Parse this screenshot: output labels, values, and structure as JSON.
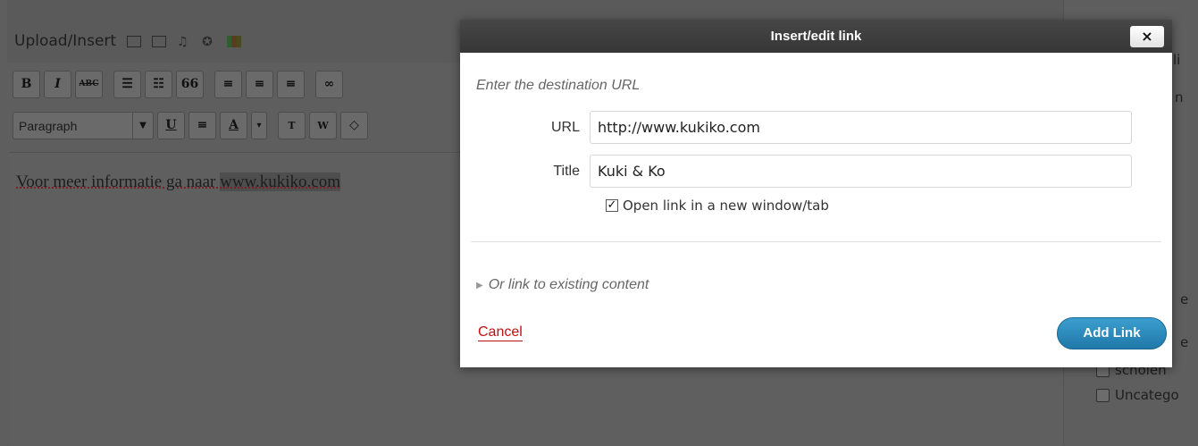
{
  "editor": {
    "upload_label": "Upload/Insert",
    "upload_icons": [
      "image-icon",
      "gallery-icon",
      "audio-icon",
      "media-icon",
      "color-icon"
    ],
    "toolbar1": [
      {
        "name": "bold-button",
        "label": "B"
      },
      {
        "name": "italic-button",
        "label": "I"
      },
      {
        "name": "strikethrough-button",
        "label": "ABC"
      },
      {
        "name": "bullet-list-button",
        "label": "☰"
      },
      {
        "name": "numbered-list-button",
        "label": "☷"
      },
      {
        "name": "blockquote-button",
        "label": "66"
      },
      {
        "name": "align-left-button",
        "label": "≡"
      },
      {
        "name": "align-center-button",
        "label": "≡"
      },
      {
        "name": "align-right-button",
        "label": "≡"
      },
      {
        "name": "insert-link-button",
        "label": "∞"
      }
    ],
    "format_select": "Paragraph",
    "toolbar2": [
      {
        "name": "underline-button",
        "label": "U"
      },
      {
        "name": "justify-button",
        "label": "≡"
      },
      {
        "name": "text-color-button",
        "label": "A"
      },
      {
        "name": "text-color-arrow-button",
        "label": "▾"
      },
      {
        "name": "paste-text-button",
        "label": "T"
      },
      {
        "name": "paste-word-button",
        "label": "W"
      },
      {
        "name": "clear-formatting-button",
        "label": "◇"
      }
    ],
    "content_text": "Voor meer informatie ga naar ",
    "content_link": "www.kukiko.com"
  },
  "sidebar": {
    "categories": [
      "scholen",
      "Uncatego"
    ]
  },
  "dialog": {
    "title": "Insert/edit link",
    "close_label": "×",
    "intro": "Enter the destination URL",
    "url_label": "URL",
    "url_value": "http://www.kukiko.com",
    "title_label": "Title",
    "title_value": "Kuki & Ko",
    "newtab_label": "Open link in a new window/tab",
    "newtab_checked": true,
    "existing_label": "Or link to existing content",
    "cancel_label": "Cancel",
    "add_label": "Add Link"
  },
  "colors": {
    "overlay": "#5e5e5e",
    "titlebar": "#3b3b3b",
    "primary_button": "#2a8bbd",
    "cancel": "#c01010"
  }
}
